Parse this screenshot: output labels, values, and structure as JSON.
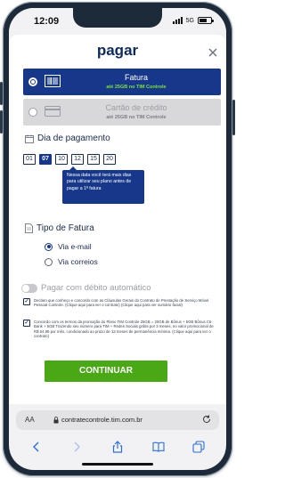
{
  "status_bar": {
    "time": "12:09",
    "carrier": "5G"
  },
  "header": {
    "title": "pagar"
  },
  "plans": [
    {
      "label": "Fatura",
      "sublabel": "até 25GB no TIM Controle",
      "selected": true
    },
    {
      "label": "Cartão de crédito",
      "sublabel": "até 25GB no TIM Controle",
      "selected": false
    }
  ],
  "payment_day": {
    "heading": "Dia de pagamento",
    "days": [
      "01",
      "07",
      "10",
      "12",
      "15",
      "20"
    ],
    "selected": "07",
    "tooltip": "Nessa data você terá mais dias para utilizar seu plano antes de pagar a 1ª fatura"
  },
  "invoice_type": {
    "heading": "Tipo de Fatura",
    "options": [
      "Via e-mail",
      "Via correios"
    ],
    "selected": "Via e-mail"
  },
  "autodebit": {
    "label": "Pagar com débito automático",
    "enabled": false
  },
  "agreements": [
    "Declaro que conheço e concordo com as Cláusulas Gerais do Contrato de Prestação de Serviço Móvel Pessoal Controle. (Clique aqui para ver o contrato) (Clique aqui para ver sumário facial)",
    "Concordo com os termos da promoção do Plano TIM Controle 25GB = 20GB de Bônus + 5GB Bônus C6 Bank + 5GB Trazendo seu número para TIM + Redes Sociais grátis por 3 meses, no valor promocional de R$ 54,99 por mês, condicionado ao prazo de 12 meses de permanência mínima. (Clique aqui para ver o contrato)"
  ],
  "cta": {
    "label": "CONTINUAR"
  },
  "browser": {
    "aa": "AA",
    "url": "contratecontrole.tim.com.br"
  },
  "colors": {
    "primary": "#17388a",
    "accent_green": "#4aa816",
    "highlight_green": "#7ee03a"
  }
}
